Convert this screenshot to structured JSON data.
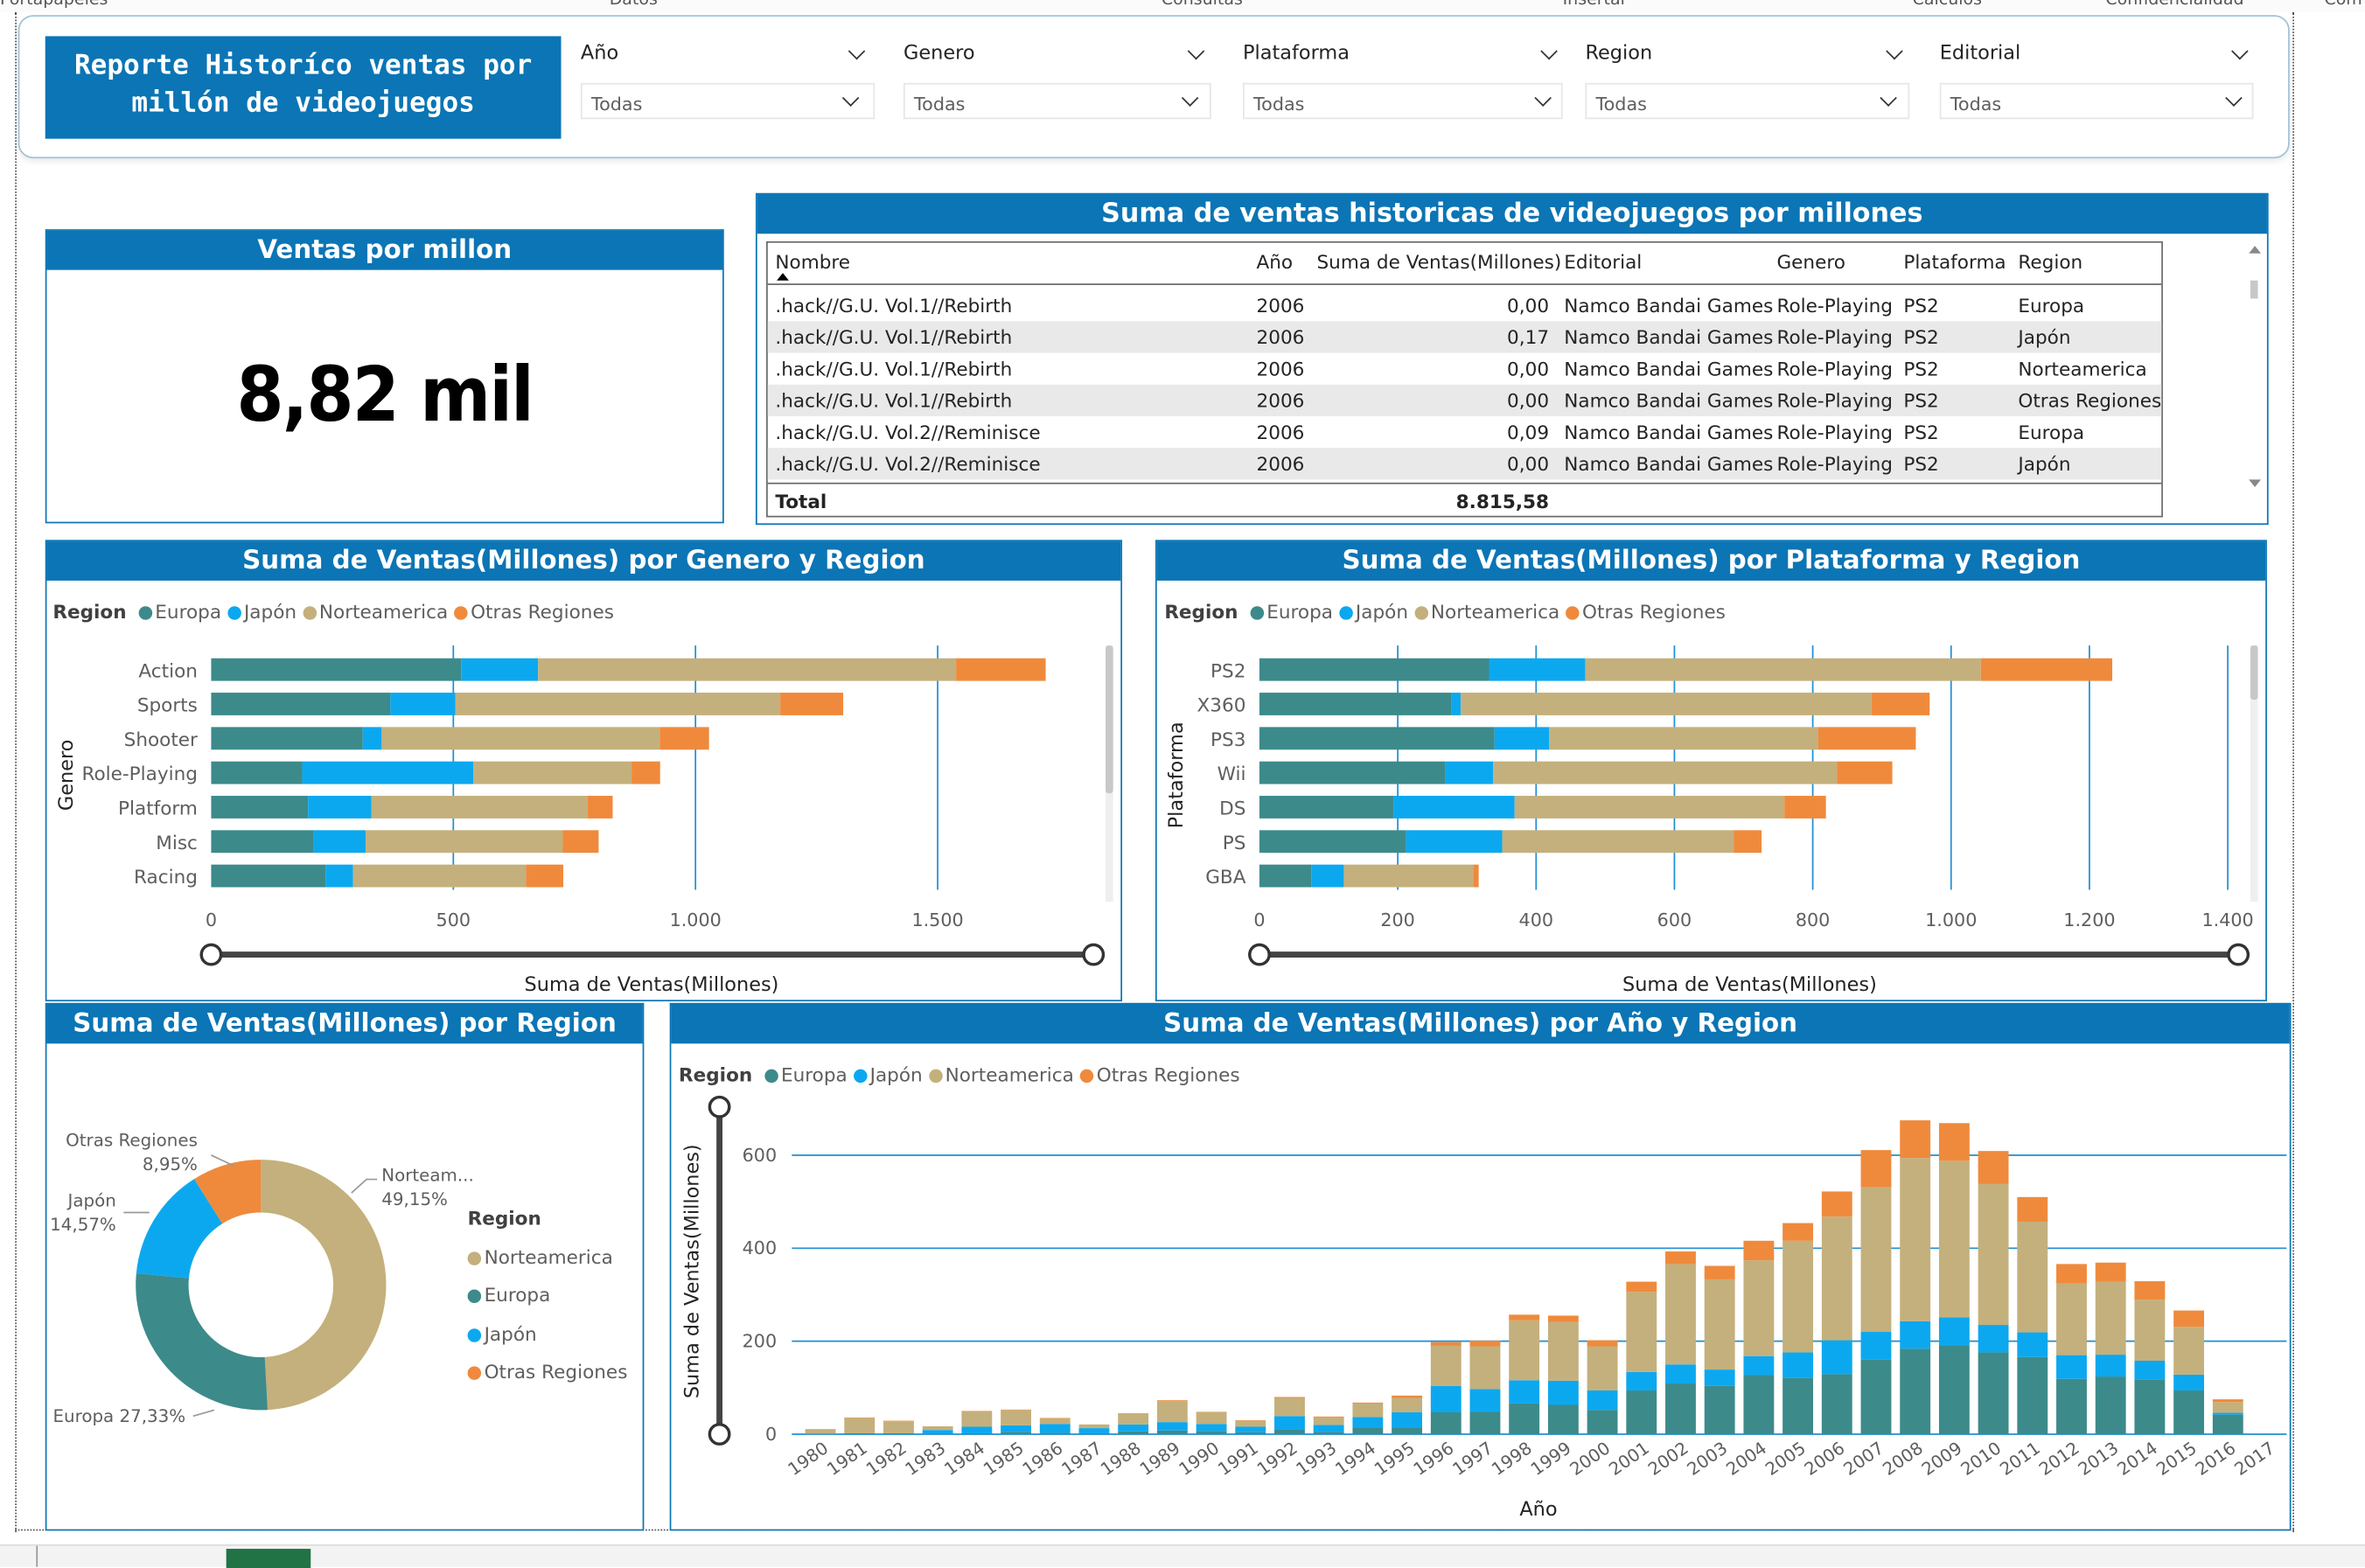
{
  "ribbon": [
    "Portapapeles",
    "Datos",
    "Consultas",
    "Insertar",
    "Cálculos",
    "Confidencialidad",
    "Com"
  ],
  "header": {
    "title": "Reporte Historíco ventas por millón de videojuegos"
  },
  "slicers": [
    {
      "label": "Año",
      "value": "Todas"
    },
    {
      "label": "Genero",
      "value": "Todas"
    },
    {
      "label": "Plataforma",
      "value": "Todas"
    },
    {
      "label": "Region",
      "value": "Todas"
    },
    {
      "label": "Editorial",
      "value": "Todas"
    }
  ],
  "card": {
    "title": "Ventas por millon",
    "value": "8,82 mil"
  },
  "table": {
    "title": "Suma de ventas historicas de videojuegos por millones",
    "columns": [
      "Nombre",
      "Año",
      "Suma de Ventas(Millones)",
      "Editorial",
      "Genero",
      "Plataforma",
      "Region"
    ],
    "rows": [
      [
        ".hack//G.U. Vol.1//Rebirth",
        "2006",
        "0,00",
        "Namco Bandai Games",
        "Role-Playing",
        "PS2",
        "Europa"
      ],
      [
        ".hack//G.U. Vol.1//Rebirth",
        "2006",
        "0,17",
        "Namco Bandai Games",
        "Role-Playing",
        "PS2",
        "Japón"
      ],
      [
        ".hack//G.U. Vol.1//Rebirth",
        "2006",
        "0,00",
        "Namco Bandai Games",
        "Role-Playing",
        "PS2",
        "Norteamerica"
      ],
      [
        ".hack//G.U. Vol.1//Rebirth",
        "2006",
        "0,00",
        "Namco Bandai Games",
        "Role-Playing",
        "PS2",
        "Otras Regiones"
      ],
      [
        ".hack//G.U. Vol.2//Reminisce",
        "2006",
        "0,09",
        "Namco Bandai Games",
        "Role-Playing",
        "PS2",
        "Europa"
      ],
      [
        ".hack//G.U. Vol.2//Reminisce",
        "2006",
        "0,00",
        "Namco Bandai Games",
        "Role-Playing",
        "PS2",
        "Japón"
      ]
    ],
    "total_label": "Total",
    "total_value": "8.815,58"
  },
  "colors": {
    "brand": "#0b75b5",
    "europa": "#3d8a8b",
    "japon": "#0ca8ef",
    "norteamerica": "#c4b07c",
    "otras": "#ef8a3c"
  },
  "legend": {
    "title": "Region",
    "items": [
      "Europa",
      "Japón",
      "Norteamerica",
      "Otras Regiones"
    ]
  },
  "genre_chart_title": "Suma de Ventas(Millones) por Genero y Region",
  "platform_chart_title": "Suma de Ventas(Millones) por Plataforma y Region",
  "pie_chart_title": "Suma de Ventas(Millones) por Region",
  "year_chart_title": "Suma de Ventas(Millones) por Año y Region",
  "chart_data": [
    {
      "type": "bar",
      "orientation": "horizontal",
      "stacked": true,
      "title": "Suma de Ventas(Millones) por Genero y Region",
      "xlabel": "Suma de Ventas(Millones)",
      "ylabel": "Genero",
      "categories": [
        "Action",
        "Sports",
        "Shooter",
        "Role-Playing",
        "Platform",
        "Misc",
        "Racing"
      ],
      "series": [
        {
          "name": "Europa",
          "values": [
            516,
            370,
            313,
            188,
            200,
            212,
            236
          ]
        },
        {
          "name": "Japón",
          "values": [
            159,
            134,
            39,
            353,
            131,
            107,
            57
          ]
        },
        {
          "name": "Norteamerica",
          "values": [
            863,
            671,
            574,
            327,
            446,
            407,
            357
          ]
        },
        {
          "name": "Otras Regiones",
          "values": [
            185,
            130,
            102,
            59,
            52,
            74,
            77
          ]
        }
      ],
      "xlim": [
        0,
        1800
      ],
      "xticks": [
        "0",
        "500",
        "1.000",
        "1.500"
      ],
      "legend": "top-left"
    },
    {
      "type": "bar",
      "orientation": "horizontal",
      "stacked": true,
      "title": "Suma de Ventas(Millones) por Plataforma y Region",
      "xlabel": "Suma de Ventas(Millones)",
      "ylabel": "Plataforma",
      "categories": [
        "PS2",
        "X360",
        "PS3",
        "Wii",
        "DS",
        "PS",
        "GBA"
      ],
      "series": [
        {
          "name": "Europa",
          "values": [
            332,
            278,
            340,
            269,
            194,
            212,
            75
          ]
        },
        {
          "name": "Japón",
          "values": [
            139,
            13,
            79,
            69,
            175,
            139,
            47
          ]
        },
        {
          "name": "Norteamerica",
          "values": [
            572,
            594,
            389,
            497,
            390,
            335,
            187
          ]
        },
        {
          "name": "Otras Regiones",
          "values": [
            190,
            84,
            141,
            80,
            60,
            40,
            8
          ]
        }
      ],
      "xlim": [
        0,
        1400
      ],
      "xticks": [
        "0",
        "200",
        "400",
        "600",
        "800",
        "1.000",
        "1.200",
        "1.400"
      ],
      "legend": "top-left"
    },
    {
      "type": "pie",
      "donut": true,
      "title": "Suma de Ventas(Millones) por Region",
      "categories": [
        "Norteamerica",
        "Europa",
        "Japón",
        "Otras Regiones"
      ],
      "values": [
        49.15,
        27.33,
        14.57,
        8.95
      ],
      "labels": [
        "Norteam... 49,15%",
        "Europa 27,33%",
        "Japón 14,57%",
        "Otras Regiones 8,95%"
      ],
      "legend": "right"
    },
    {
      "type": "bar",
      "stacked": true,
      "title": "Suma de Ventas(Millones) por Año y Region",
      "xlabel": "Año",
      "ylabel": "Suma de Ventas(Millones)",
      "categories": [
        "1980",
        "1981",
        "1982",
        "1983",
        "1984",
        "1985",
        "1986",
        "1987",
        "1988",
        "1989",
        "1990",
        "1991",
        "1992",
        "1993",
        "1994",
        "1995",
        "1996",
        "1997",
        "1998",
        "1999",
        "2000",
        "2001",
        "2002",
        "2003",
        "2004",
        "2005",
        "2006",
        "2007",
        "2008",
        "2009",
        "2010",
        "2011",
        "2012",
        "2013",
        "2014",
        "2015",
        "2016",
        "2017"
      ],
      "series": [
        {
          "name": "Europa",
          "values": [
            1,
            2,
            2,
            1,
            2,
            5,
            3,
            2,
            6,
            8,
            7,
            4,
            11,
            5,
            14,
            14,
            47,
            48,
            66,
            63,
            52,
            94,
            109,
            104,
            127,
            121,
            129,
            160,
            184,
            191,
            176,
            166,
            119,
            124,
            118,
            94,
            42,
            0
          ]
        },
        {
          "name": "Japón",
          "values": [
            0,
            0,
            0,
            8,
            14,
            14,
            19,
            11,
            15,
            18,
            15,
            12,
            28,
            15,
            23,
            33,
            57,
            49,
            50,
            52,
            42,
            40,
            41,
            35,
            41,
            55,
            73,
            60,
            59,
            60,
            59,
            53,
            51,
            47,
            40,
            34,
            4,
            0
          ]
        },
        {
          "name": "Norteamerica",
          "values": [
            10,
            33,
            26,
            8,
            33,
            33,
            12,
            8,
            23,
            45,
            25,
            13,
            39,
            16,
            29,
            31,
            86,
            92,
            129,
            126,
            95,
            172,
            216,
            194,
            206,
            240,
            266,
            311,
            351,
            337,
            303,
            238,
            154,
            157,
            131,
            103,
            23,
            0
          ]
        },
        {
          "name": "Otras Regiones",
          "values": [
            0,
            1,
            1,
            0,
            1,
            1,
            1,
            0,
            1,
            2,
            1,
            1,
            2,
            2,
            2,
            5,
            8,
            12,
            12,
            14,
            13,
            22,
            27,
            29,
            42,
            38,
            54,
            80,
            81,
            81,
            71,
            53,
            42,
            41,
            40,
            35,
            6,
            0
          ]
        }
      ],
      "ylim": [
        0,
        700
      ],
      "yticks": [
        "0",
        "200",
        "400",
        "600"
      ],
      "legend": "top-left"
    }
  ]
}
